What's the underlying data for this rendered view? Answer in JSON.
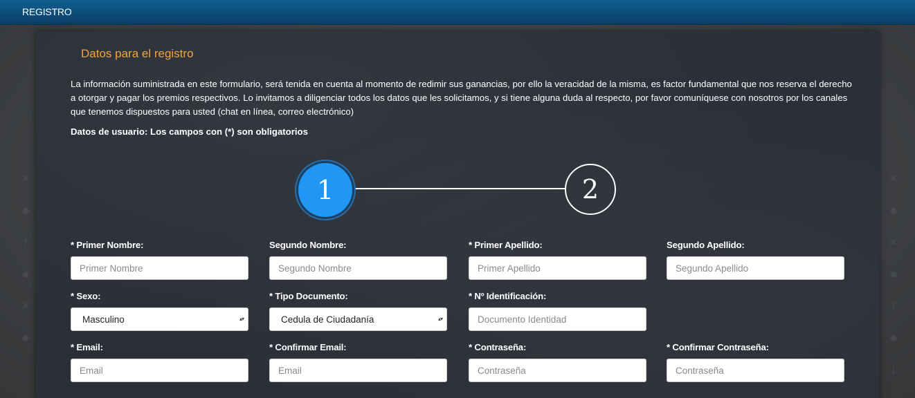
{
  "header": {
    "title": "REGISTRO"
  },
  "section": {
    "title": "Datos para el registro",
    "intro": "La información suministrada en este formulario, será tenida en cuenta al momento de redimir sus ganancias, por ello la veracidad de la misma, es factor fundamental que nos reserva el derecho a otorgar y pagar los premios respectivos. Lo invitamos a diligenciar todos los datos que les solicitamos, y si tiene alguna duda al respecto, por favor comuníquese con nosotros por los canales que tenemos dispuestos para usted (chat en línea, correo electrónico)",
    "required_note": "Datos de usuario: Los campos con (*) son obligatorios"
  },
  "stepper": {
    "steps": [
      {
        "label": "1",
        "active": true
      },
      {
        "label": "2",
        "active": false
      }
    ],
    "active_color": "#2196f3"
  },
  "form": {
    "primer_nombre": {
      "label": "* Primer Nombre:",
      "placeholder": "Primer Nombre",
      "value": ""
    },
    "segundo_nombre": {
      "label": "Segundo Nombre:",
      "placeholder": "Segundo Nombre",
      "value": ""
    },
    "primer_apellido": {
      "label": "* Primer Apellido:",
      "placeholder": "Primer Apellido",
      "value": ""
    },
    "segundo_apellido": {
      "label": "Segundo Apellido:",
      "placeholder": "Segundo Apellido",
      "value": ""
    },
    "sexo": {
      "label": "* Sexo:",
      "value": "Masculino"
    },
    "tipo_documento": {
      "label": "* Tipo Documento:",
      "value": "Cedula de Ciudadanía"
    },
    "identificacion": {
      "label": "* Nº Identificación:",
      "placeholder": "Documento Identidad",
      "value": ""
    },
    "email": {
      "label": "* Email:",
      "placeholder": "Email",
      "value": ""
    },
    "confirmar_email": {
      "label": "* Confirmar Email:",
      "placeholder": "Email",
      "value": ""
    },
    "contrasena": {
      "label": "* Contraseña:",
      "placeholder": "Contraseña",
      "value": ""
    },
    "confirmar_contrasena": {
      "label": "* Confirmar Contraseña:",
      "placeholder": "Contraseña",
      "value": ""
    }
  },
  "colors": {
    "header_bg": "#0f5f90",
    "panel_bg": "#2b2f37",
    "section_title": "#f0a63a"
  }
}
